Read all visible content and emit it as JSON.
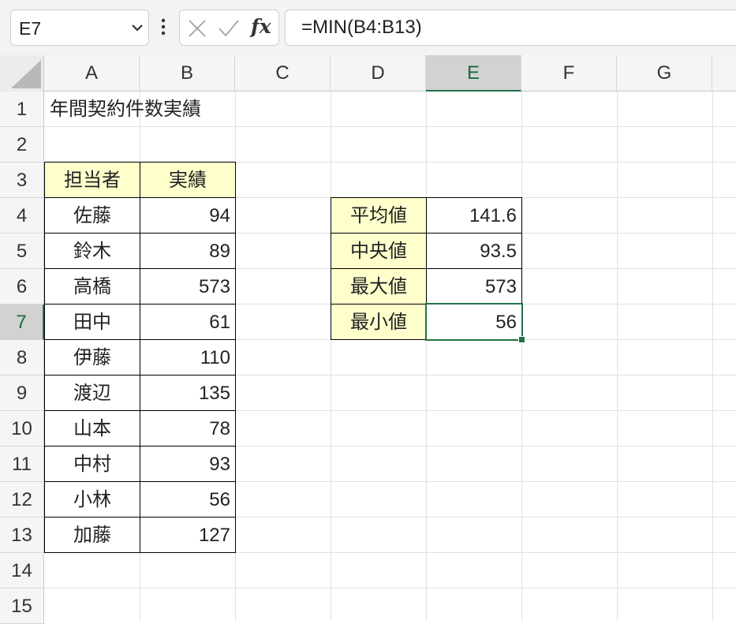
{
  "formula_bar": {
    "name_box": "E7",
    "insert_function_label": "fx",
    "formula": "=MIN(B4:B13)"
  },
  "columns": [
    "A",
    "B",
    "C",
    "D",
    "E",
    "F",
    "G"
  ],
  "rows": [
    "1",
    "2",
    "3",
    "4",
    "5",
    "6",
    "7",
    "8",
    "9",
    "10",
    "11",
    "12",
    "13",
    "14",
    "15"
  ],
  "sheet": {
    "title": "年間契約件数実績",
    "table": {
      "headers": [
        "担当者",
        "実績"
      ],
      "rows": [
        {
          "name": "佐藤",
          "value": "94"
        },
        {
          "name": "鈴木",
          "value": "89"
        },
        {
          "name": "高橋",
          "value": "573"
        },
        {
          "name": "田中",
          "value": "61"
        },
        {
          "name": "伊藤",
          "value": "110"
        },
        {
          "name": "渡辺",
          "value": "135"
        },
        {
          "name": "山本",
          "value": "78"
        },
        {
          "name": "中村",
          "value": "93"
        },
        {
          "name": "小林",
          "value": "56"
        },
        {
          "name": "加藤",
          "value": "127"
        }
      ]
    },
    "stats": [
      {
        "label": "平均値",
        "value": "141.6"
      },
      {
        "label": "中央値",
        "value": "93.5"
      },
      {
        "label": "最大値",
        "value": "573"
      },
      {
        "label": "最小値",
        "value": "56"
      }
    ]
  },
  "colors": {
    "selection_accent": "#217346",
    "header_fill": "#ffffcc"
  },
  "icons": {
    "name_box_dropdown": "chevron-down-icon",
    "more": "kebab-icon",
    "cancel": "close-icon",
    "confirm": "check-icon"
  }
}
